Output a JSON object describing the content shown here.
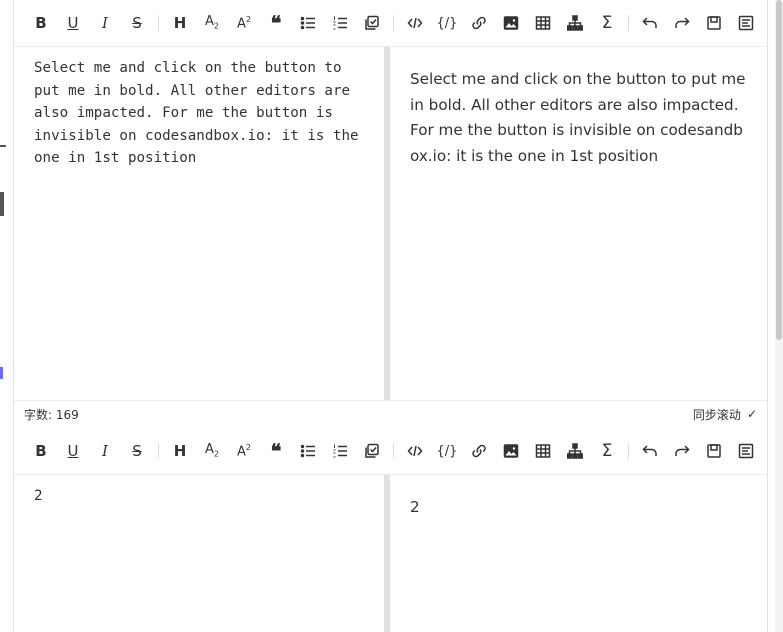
{
  "editors": [
    {
      "source_text": "Select me and click on the button to put me in bold. All other editors are also impacted. For me the button is invisible on codesandbox.io: it is the one in 1st position",
      "preview_text": "Select me and click on the button to put me in bold. All other editors are also impacted. For me the button is invisible on codesandbox.io: it is the one in 1st position",
      "footer": {
        "word_count_label": "字数: 169",
        "sync_scroll_label": "同步滚动",
        "sync_scroll_check": "✓"
      }
    },
    {
      "source_text": "2",
      "preview_text": "2"
    }
  ],
  "toolbar_icons": [
    "bold-icon",
    "underline-icon",
    "italic-icon",
    "strikethrough-icon",
    "heading-icon",
    "subscript-icon",
    "superscript-icon",
    "quote-icon",
    "unordered-list-icon",
    "ordered-list-icon",
    "task-list-icon",
    "inline-code-icon",
    "code-block-icon",
    "link-icon",
    "image-icon",
    "table-icon",
    "mermaid-icon",
    "formula-icon",
    "undo-icon",
    "redo-icon",
    "save-icon",
    "toc-icon"
  ]
}
